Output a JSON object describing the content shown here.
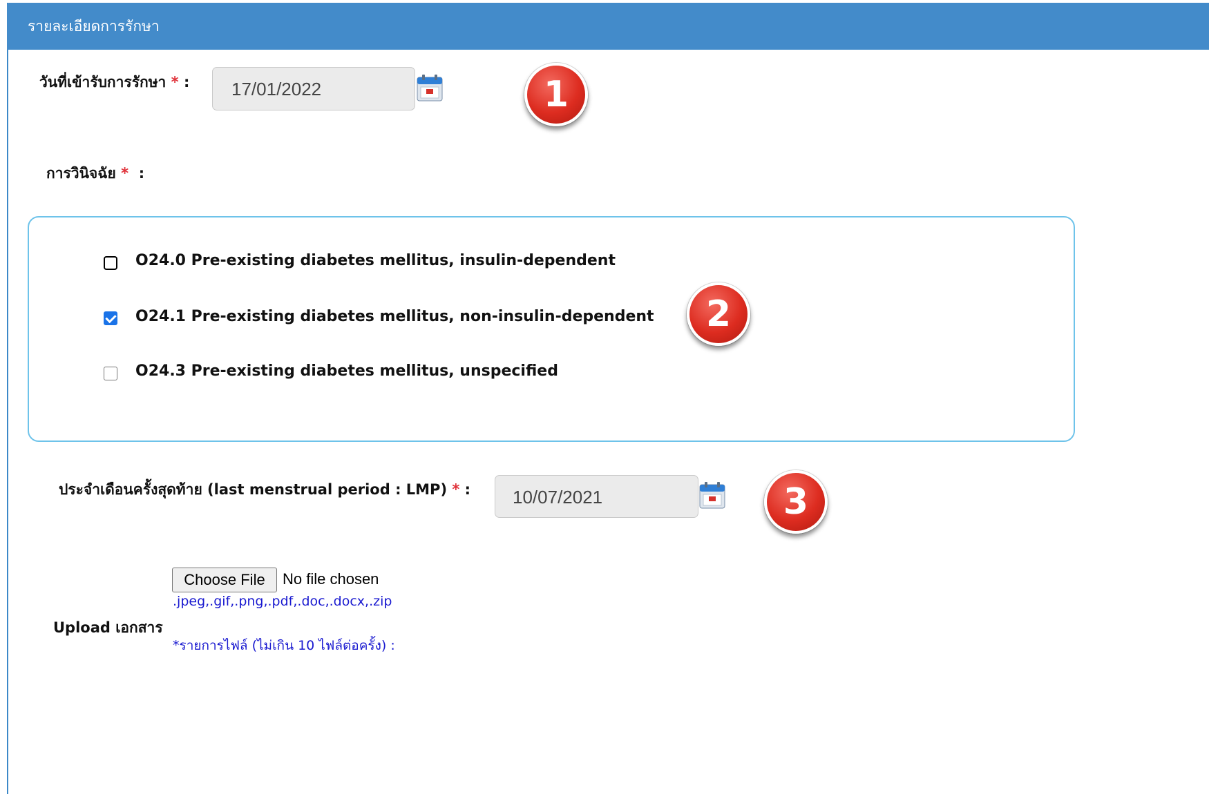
{
  "header": {
    "title": "รายละเอียดการรักษา"
  },
  "admission": {
    "label": "วันที่เข้ารับการรักษา",
    "required_mark": "*",
    "colon": ":",
    "date_value": "17/01/2022"
  },
  "diagnosis": {
    "label": "การวินิจฉัย",
    "required_mark": "*",
    "colon": ":",
    "options": [
      {
        "code_text": "O24.0 Pre-existing diabetes mellitus, insulin-dependent",
        "checked": false
      },
      {
        "code_text": "O24.1 Pre-existing diabetes mellitus, non-insulin-dependent",
        "checked": true
      },
      {
        "code_text": "O24.3 Pre-existing diabetes mellitus, unspecified",
        "checked": false
      }
    ]
  },
  "lmp": {
    "label": "ประจำเดือนครั้งสุดท้าย (last menstrual period : LMP)",
    "required_mark": "*",
    "colon": ":",
    "date_value": "10/07/2021"
  },
  "upload": {
    "label": "Upload เอกสาร",
    "button_label": "Choose File",
    "status": "No file chosen",
    "allowed_types": ".jpeg,.gif,.png,.pdf,.doc,.docx,.zip",
    "file_list_note": "*รายการไฟล์ (ไม่เกิน 10 ไฟล์ต่อครั้ง) :"
  },
  "badges": [
    "1",
    "2",
    "3"
  ],
  "colors": {
    "header_bg": "#438bca",
    "required": "#e0323a",
    "box_border": "#6ec3ea",
    "note_text": "#1a1ad0",
    "badge_red": "#dd2c20"
  },
  "icons": {
    "date_picker": "calendar-icon"
  }
}
